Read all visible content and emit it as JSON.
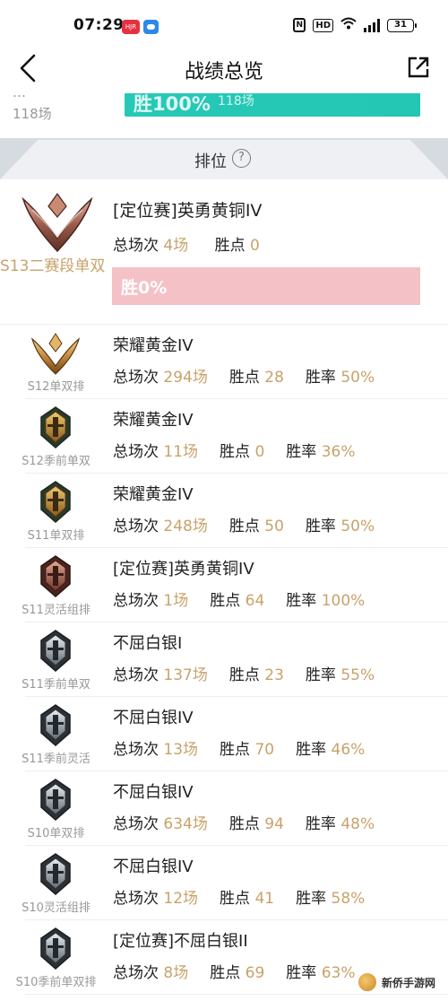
{
  "status_bar": {
    "time": "07:29",
    "app1_label": "HJR",
    "battery": "31"
  },
  "nav": {
    "title": "战绩总览"
  },
  "previous_section": {
    "partial_text": "…",
    "count": "118场",
    "bar_text": "胜100%",
    "bar_sub": "118场"
  },
  "rank_header": {
    "title": "排位",
    "help": "?"
  },
  "featured": {
    "season": "S13二赛段单双",
    "title": "[定位赛]英勇黄铜IV",
    "total_label": "总场次",
    "total_value": "4场",
    "points_label": "胜点",
    "points_value": "0",
    "winbar_text": "胜0%",
    "colors": {
      "winbar": "#f4c1c6",
      "accent": "#c8a26a"
    }
  },
  "labels": {
    "total": "总场次",
    "points": "胜点",
    "rate": "胜率"
  },
  "seasons": [
    {
      "season": "S12单双排",
      "title": "荣耀黄金IV",
      "total": "294场",
      "points": "28",
      "rate": "50%",
      "emblem": "gold-wings-emblem"
    },
    {
      "season": "S12季前单双",
      "title": "荣耀黄金IV",
      "total": "11场",
      "points": "0",
      "rate": "36%",
      "emblem": "gold-helmet-emblem"
    },
    {
      "season": "S11单双排",
      "title": "荣耀黄金IV",
      "total": "248场",
      "points": "50",
      "rate": "50%",
      "emblem": "gold-helmet-emblem"
    },
    {
      "season": "S11灵活组排",
      "title": "[定位赛]英勇黄铜IV",
      "total": "1场",
      "points": "64",
      "rate": "100%",
      "emblem": "bronze-helmet-emblem"
    },
    {
      "season": "S11季前单双",
      "title": "不屈白银I",
      "total": "137场",
      "points": "23",
      "rate": "55%",
      "emblem": "silver-helmet-emblem"
    },
    {
      "season": "S11季前灵活",
      "title": "不屈白银IV",
      "total": "13场",
      "points": "70",
      "rate": "46%",
      "emblem": "silver-helmet-emblem"
    },
    {
      "season": "S10单双排",
      "title": "不屈白银IV",
      "total": "634场",
      "points": "94",
      "rate": "48%",
      "emblem": "silver-helmet-emblem"
    },
    {
      "season": "S10灵活组排",
      "title": "不屈白银IV",
      "total": "12场",
      "points": "41",
      "rate": "58%",
      "emblem": "silver-helmet-emblem"
    },
    {
      "season": "S10季前单双排",
      "title": "[定位赛]不屈白银II",
      "total": "8场",
      "points": "69",
      "rate": "63%",
      "emblem": "silver-helmet-emblem"
    }
  ],
  "watermark": {
    "text": "新侨手游网"
  }
}
